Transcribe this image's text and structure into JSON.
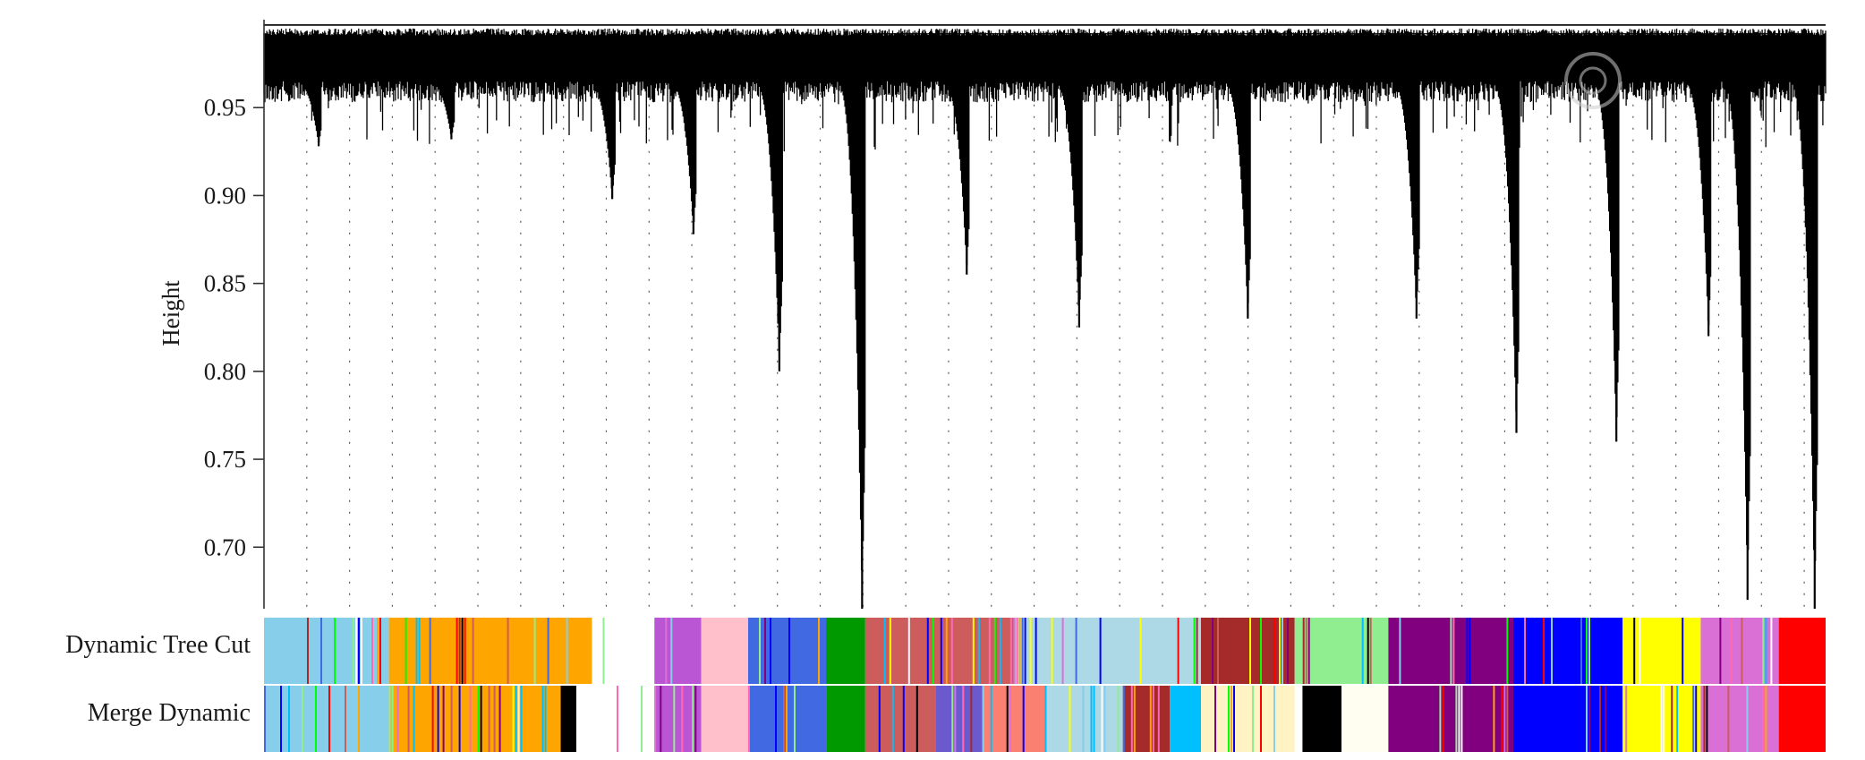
{
  "chart_data": {
    "type": "dendrogram",
    "title": "",
    "xlabel": "",
    "ylabel": "Height",
    "ylim": [
      0.665,
      1.0
    ],
    "y_ticks": [
      0.7,
      0.75,
      0.8,
      0.85,
      0.9,
      0.95
    ],
    "y_tick_labels": [
      "0.70",
      "0.75",
      "0.80",
      "0.85",
      "0.90",
      "0.95"
    ],
    "grid": "vertical-dotted",
    "leaf_floor": 0.965,
    "branches": [
      {
        "x": 0.035,
        "min_height": 0.928
      },
      {
        "x": 0.12,
        "min_height": 0.932
      },
      {
        "x": 0.223,
        "min_height": 0.898
      },
      {
        "x": 0.275,
        "min_height": 0.878
      },
      {
        "x": 0.33,
        "min_height": 0.8
      },
      {
        "x": 0.383,
        "min_height": 0.665
      },
      {
        "x": 0.45,
        "min_height": 0.855
      },
      {
        "x": 0.522,
        "min_height": 0.825
      },
      {
        "x": 0.63,
        "min_height": 0.83
      },
      {
        "x": 0.738,
        "min_height": 0.83
      },
      {
        "x": 0.802,
        "min_height": 0.765
      },
      {
        "x": 0.866,
        "min_height": 0.76
      },
      {
        "x": 0.925,
        "min_height": 0.82
      },
      {
        "x": 0.95,
        "min_height": 0.67
      },
      {
        "x": 0.993,
        "min_height": 0.665
      }
    ],
    "color_tracks": [
      {
        "name": "Dynamic Tree Cut",
        "segments": [
          {
            "start": 0.0,
            "end": 0.08,
            "color": "#87ceeb",
            "stripe": "mixed"
          },
          {
            "start": 0.08,
            "end": 0.21,
            "color": "#ffa500",
            "stripe": "mixed"
          },
          {
            "start": 0.21,
            "end": 0.25,
            "color": "#ffffff",
            "stripe": "sparse"
          },
          {
            "start": 0.25,
            "end": 0.28,
            "color": "#ba55d3",
            "stripe": "mixed"
          },
          {
            "start": 0.28,
            "end": 0.31,
            "color": "#ffc0cb",
            "stripe": "none"
          },
          {
            "start": 0.31,
            "end": 0.38,
            "color": "#4169e1",
            "stripe": "mixed"
          },
          {
            "start": 0.36,
            "end": 0.385,
            "color": "#009900",
            "stripe": "none"
          },
          {
            "start": 0.385,
            "end": 0.48,
            "color": "#cd5c5c",
            "stripe": "mixed"
          },
          {
            "start": 0.48,
            "end": 0.6,
            "color": "#add8e6",
            "stripe": "mixed"
          },
          {
            "start": 0.6,
            "end": 0.66,
            "color": "#a52a2a",
            "stripe": "mixed"
          },
          {
            "start": 0.66,
            "end": 0.72,
            "color": "#90ee90",
            "stripe": "mixed"
          },
          {
            "start": 0.72,
            "end": 0.8,
            "color": "#800080",
            "stripe": "mixed"
          },
          {
            "start": 0.8,
            "end": 0.87,
            "color": "#0000ff",
            "stripe": "mixed"
          },
          {
            "start": 0.87,
            "end": 0.92,
            "color": "#ffff00",
            "stripe": "mixed"
          },
          {
            "start": 0.92,
            "end": 0.97,
            "color": "#da70d6",
            "stripe": "mixed"
          },
          {
            "start": 0.97,
            "end": 1.0,
            "color": "#ff0000",
            "stripe": "none"
          }
        ]
      },
      {
        "name": "Merge Dynamic",
        "segments": [
          {
            "start": 0.0,
            "end": 0.08,
            "color": "#87ceeb",
            "stripe": "mixed"
          },
          {
            "start": 0.08,
            "end": 0.2,
            "color": "#ffa500",
            "stripe": "mixed"
          },
          {
            "start": 0.19,
            "end": 0.2,
            "color": "#000000",
            "stripe": "none"
          },
          {
            "start": 0.2,
            "end": 0.25,
            "color": "#ffffff",
            "stripe": "sparse"
          },
          {
            "start": 0.25,
            "end": 0.28,
            "color": "#ba55d3",
            "stripe": "mixed"
          },
          {
            "start": 0.28,
            "end": 0.31,
            "color": "#ffc0cb",
            "stripe": "none"
          },
          {
            "start": 0.31,
            "end": 0.36,
            "color": "#4169e1",
            "stripe": "mixed"
          },
          {
            "start": 0.36,
            "end": 0.385,
            "color": "#009900",
            "stripe": "none"
          },
          {
            "start": 0.385,
            "end": 0.43,
            "color": "#cd5c5c",
            "stripe": "mixed"
          },
          {
            "start": 0.43,
            "end": 0.46,
            "color": "#6a5acd",
            "stripe": "mixed"
          },
          {
            "start": 0.46,
            "end": 0.5,
            "color": "#fa8072",
            "stripe": "mixed"
          },
          {
            "start": 0.5,
            "end": 0.55,
            "color": "#add8e6",
            "stripe": "mixed"
          },
          {
            "start": 0.55,
            "end": 0.58,
            "color": "#a52a2a",
            "stripe": "mixed"
          },
          {
            "start": 0.58,
            "end": 0.6,
            "color": "#00bfff",
            "stripe": "none"
          },
          {
            "start": 0.6,
            "end": 0.66,
            "color": "#fff3c4",
            "stripe": "mixed"
          },
          {
            "start": 0.665,
            "end": 0.69,
            "color": "#000000",
            "stripe": "none"
          },
          {
            "start": 0.69,
            "end": 0.72,
            "color": "#fffef0",
            "stripe": "sparse"
          },
          {
            "start": 0.72,
            "end": 0.8,
            "color": "#800080",
            "stripe": "mixed"
          },
          {
            "start": 0.8,
            "end": 0.87,
            "color": "#0000ff",
            "stripe": "mixed"
          },
          {
            "start": 0.87,
            "end": 0.92,
            "color": "#ffff00",
            "stripe": "mixed"
          },
          {
            "start": 0.92,
            "end": 0.97,
            "color": "#da70d6",
            "stripe": "mixed"
          },
          {
            "start": 0.97,
            "end": 1.0,
            "color": "#ff0000",
            "stripe": "none"
          }
        ]
      }
    ]
  }
}
